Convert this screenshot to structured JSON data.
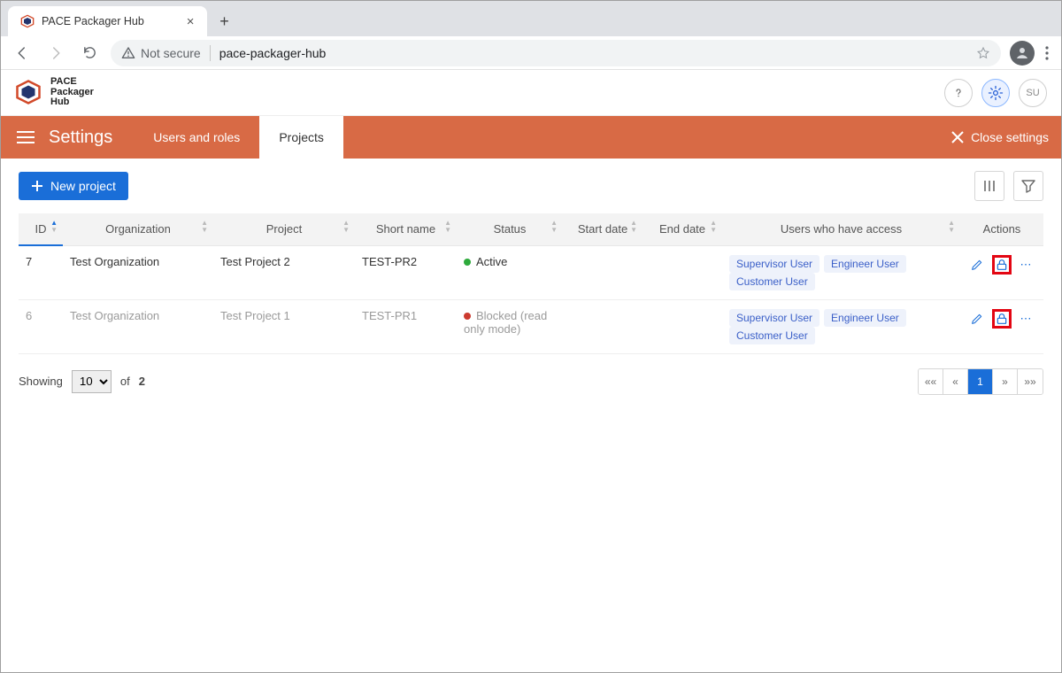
{
  "browser": {
    "tab_title": "PACE Packager Hub",
    "not_secure": "Not secure",
    "url": "pace-packager-hub"
  },
  "brand": {
    "l1": "PACE",
    "l2": "Packager",
    "l3": "Hub",
    "su": "SU"
  },
  "settingsbar": {
    "title": "Settings",
    "tabs": {
      "users": "Users and roles",
      "projects": "Projects"
    },
    "close": "Close settings"
  },
  "toolbar": {
    "new_project": "New project"
  },
  "columns": {
    "id": "ID",
    "org": "Organization",
    "project": "Project",
    "shortname": "Short name",
    "status": "Status",
    "start": "Start date",
    "end": "End date",
    "users": "Users who have access",
    "actions": "Actions"
  },
  "rows": [
    {
      "id": "7",
      "org": "Test Organization",
      "project": "Test Project 2",
      "shortname": "TEST-PR2",
      "status": "Active",
      "status_kind": "green",
      "start": "",
      "end": "",
      "users": [
        "Supervisor User",
        "Engineer User",
        "Customer User"
      ],
      "muted": false
    },
    {
      "id": "6",
      "org": "Test Organization",
      "project": "Test Project 1",
      "shortname": "TEST-PR1",
      "status": "Blocked (read only mode)",
      "status_kind": "red",
      "start": "",
      "end": "",
      "users": [
        "Supervisor User",
        "Engineer User",
        "Customer User"
      ],
      "muted": true
    }
  ],
  "footer": {
    "showing": "Showing",
    "of": "of",
    "total": "2",
    "page_size": "10",
    "pager": {
      "first": "««",
      "prev": "«",
      "current": "1",
      "next": "»",
      "last": "»»"
    }
  }
}
